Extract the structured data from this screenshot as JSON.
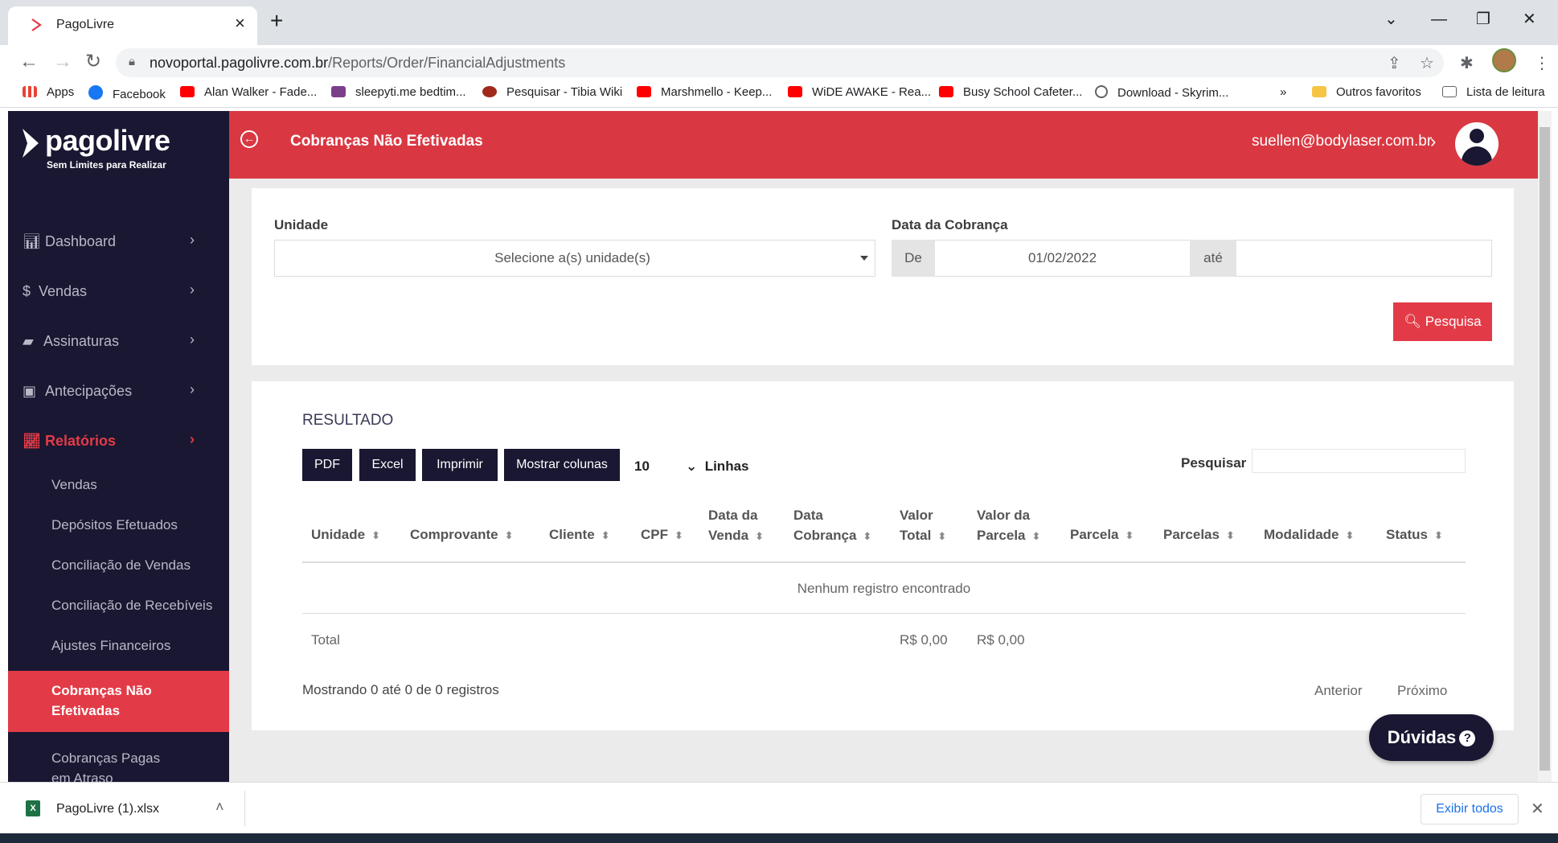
{
  "browser": {
    "tab_title": "PagoLivre",
    "url_host": "novoportal.pagolivre.com.br",
    "url_path": "/Reports/Order/FinancialAdjustments",
    "bookmarks": [
      {
        "label": "Apps",
        "icon": "apps-grid-icon"
      },
      {
        "label": "Facebook",
        "icon": "facebook-icon"
      },
      {
        "label": "Alan Walker - Fade...",
        "icon": "youtube-icon"
      },
      {
        "label": "sleepyti.me bedtim...",
        "icon": "sleepytime-icon"
      },
      {
        "label": "Pesquisar - Tibia Wiki",
        "icon": "tibia-icon"
      },
      {
        "label": "Marshmello - Keep...",
        "icon": "youtube-icon"
      },
      {
        "label": "WiDE AWAKE - Rea...",
        "icon": "youtube-icon"
      },
      {
        "label": "Busy School Cafeter...",
        "icon": "youtube-icon"
      },
      {
        "label": "Download - Skyrim...",
        "icon": "download-icon"
      }
    ],
    "more_bookmarks": "»",
    "other_favorites": "Outros favoritos",
    "reading_list": "Lista de leitura"
  },
  "sidebar": {
    "logo": "pagolivre",
    "tagline": "Sem Limites para Realizar",
    "items": [
      {
        "label": "Dashboard",
        "icon": "bar-chart-icon"
      },
      {
        "label": "Vendas",
        "icon": "dollar-icon"
      },
      {
        "label": "Assinaturas",
        "icon": "book-icon"
      },
      {
        "label": "Antecipações",
        "icon": "money-icon"
      },
      {
        "label": "Relatórios",
        "icon": "line-chart-icon"
      }
    ],
    "subitems": [
      "Vendas",
      "Depósitos Efetuados",
      "Conciliação de Vendas",
      "Conciliação de Recebíveis",
      "Ajustes Financeiros",
      "Cobranças Não Efetivadas",
      "Cobranças Pagas em Atraso"
    ]
  },
  "header": {
    "title": "Cobranças Não Efetivadas",
    "user_email": "suellen@bodylaser.com.br"
  },
  "filters": {
    "unit_label": "Unidade",
    "unit_placeholder": "Selecione a(s) unidade(s)",
    "date_label": "Data da Cobrança",
    "from_label": "De",
    "from_value": "01/02/2022",
    "to_label": "até",
    "to_value": "",
    "search_button": "Pesquisa"
  },
  "results": {
    "title": "RESULTADO",
    "buttons": [
      "PDF",
      "Excel",
      "Imprimir",
      "Mostrar colunas"
    ],
    "page_length": "10",
    "page_length_label": "Linhas",
    "search_label": "Pesquisar",
    "columns": [
      [
        "Unidade"
      ],
      [
        "Comprovante"
      ],
      [
        "Cliente"
      ],
      [
        "CPF"
      ],
      [
        "Data da",
        "Venda"
      ],
      [
        "Data",
        "Cobrança"
      ],
      [
        "Valor",
        "Total"
      ],
      [
        "Valor da",
        "Parcela"
      ],
      [
        "Parcela"
      ],
      [
        "Parcelas"
      ],
      [
        "Modalidade"
      ],
      [
        "Status"
      ]
    ],
    "empty_message": "Nenhum registro encontrado",
    "total_label": "Total",
    "total_value": "R$ 0,00",
    "total_parcela": "R$ 0,00",
    "info": "Mostrando 0 até 0 de 0 registros",
    "prev": "Anterior",
    "next": "Próximo"
  },
  "help_button": "Dúvidas",
  "downloads": {
    "file": "PagoLivre (1).xlsx",
    "show_all": "Exibir todos"
  },
  "colors": {
    "brand_red": "#e23b47",
    "sidebar_bg": "#191731"
  }
}
